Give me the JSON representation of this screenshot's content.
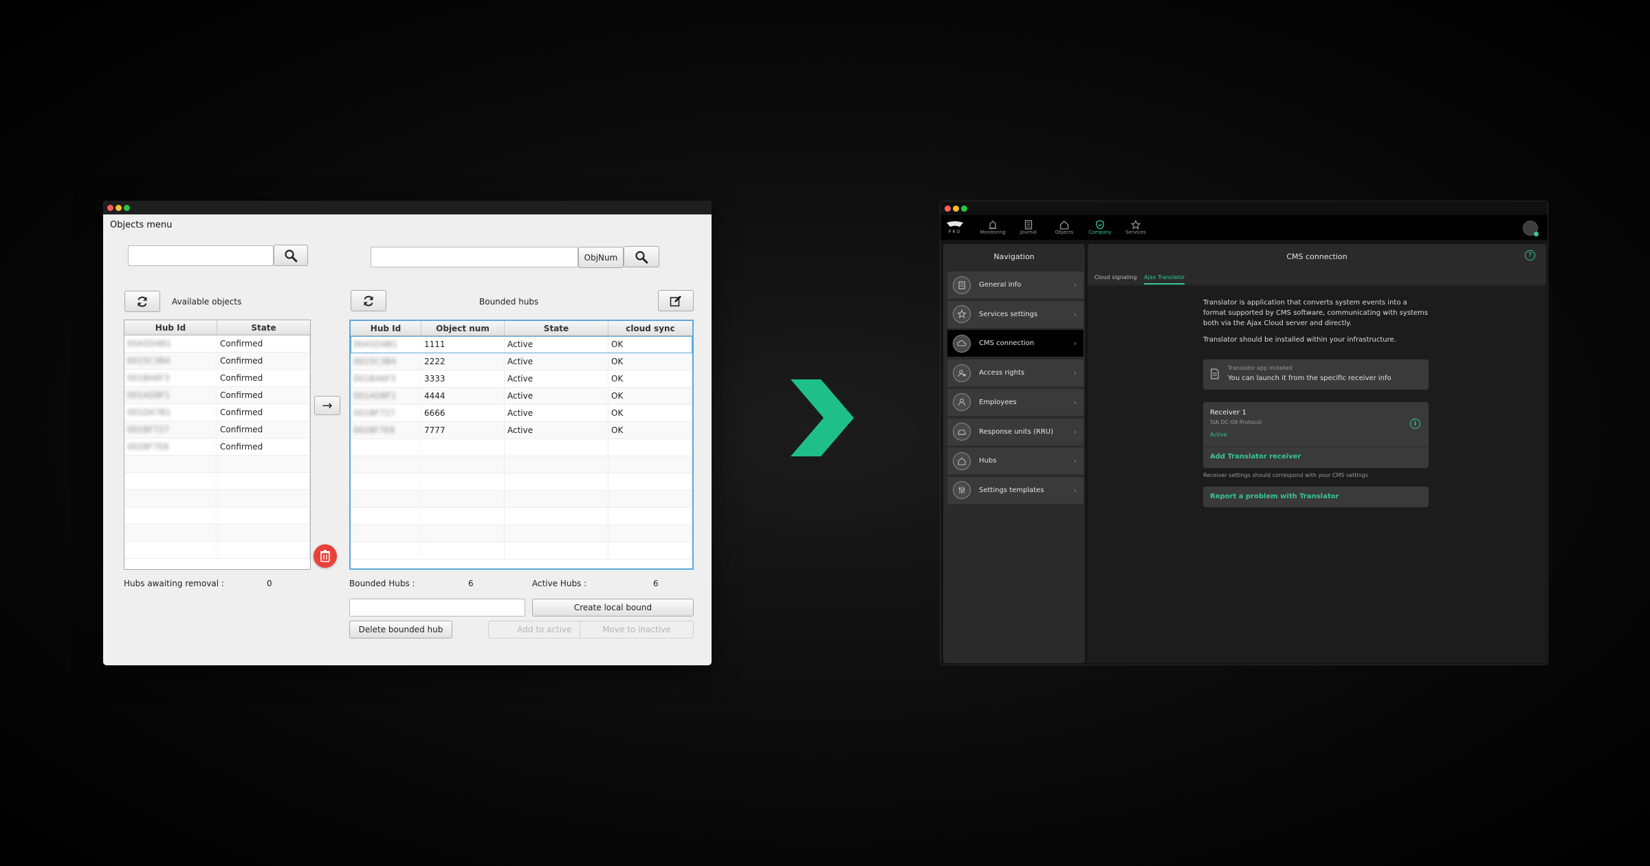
{
  "left": {
    "menu_title": "Objects menu",
    "objnum_label": "ObjNum",
    "available_label": "Available objects",
    "bounded_label": "Bounded hubs",
    "available_table": {
      "headers": [
        "Hub Id",
        "State"
      ],
      "rows": [
        [
          "00A5D4B1",
          "Confirmed"
        ],
        [
          "0015C3B4",
          "Confirmed"
        ],
        [
          "001BA6F3",
          "Confirmed"
        ],
        [
          "001AD8F1",
          "Confirmed"
        ],
        [
          "001DA7B1",
          "Confirmed"
        ],
        [
          "001BF727",
          "Confirmed"
        ],
        [
          "0028F7E8",
          "Confirmed"
        ]
      ]
    },
    "bounded_table": {
      "headers": [
        "Hub Id",
        "Object num",
        "State",
        "cloud sync"
      ],
      "rows": [
        [
          "00A5D4B1",
          "1111",
          "Active",
          "OK"
        ],
        [
          "0015C3B4",
          "2222",
          "Active",
          "OK"
        ],
        [
          "001BA6F3",
          "3333",
          "Active",
          "OK"
        ],
        [
          "001AD8F1",
          "4444",
          "Active",
          "OK"
        ],
        [
          "001BF727",
          "6666",
          "Active",
          "OK"
        ],
        [
          "0028F7E8",
          "7777",
          "Active",
          "OK"
        ]
      ]
    },
    "awaiting_label": "Hubs awaiting removal :",
    "awaiting_value": "0",
    "bounded_count_label": "Bounded Hubs :",
    "bounded_count_value": "6",
    "active_count_label": "Active Hubs :",
    "active_count_value": "6",
    "create_local_bound": "Create local bound",
    "delete_bounded_hub": "Delete bounded hub",
    "add_to_active": "Add to active",
    "move_to_inactive": "Move to inactive"
  },
  "right": {
    "logo_text": "PRO",
    "top_nav": [
      "Monitoring",
      "Journal",
      "Objects",
      "Company",
      "Services"
    ],
    "navigation_title": "Navigation",
    "sidebar": [
      "General info",
      "Services settings",
      "CMS connection",
      "Access rights",
      "Employees",
      "Response units (RRU)",
      "Hubs",
      "Settings templates"
    ],
    "content_title": "CMS connection",
    "tabs": [
      "Cloud signaling",
      "Ajax Translator"
    ],
    "desc1": "Translator is application that converts system events into a format supported by CMS software, communicating with systems both via the Ajax Cloud server and directly.",
    "desc2": "Translator should be installed within your infrastructure.",
    "installed_title": "Translator app installed",
    "installed_text": "You can launch it from the specific receiver info",
    "receiver_name": "Receiver 1",
    "receiver_protocol": "SIA DC-09 Protocol",
    "receiver_status": "Active",
    "add_receiver": "Add Translator receiver",
    "receiver_note": "Receiver settings should correspond with your CMS settings",
    "report_problem": "Report a problem with Translator"
  },
  "colors": {
    "accent": "#35c795",
    "danger": "#e8413a",
    "selection": "#5aa9dc"
  }
}
